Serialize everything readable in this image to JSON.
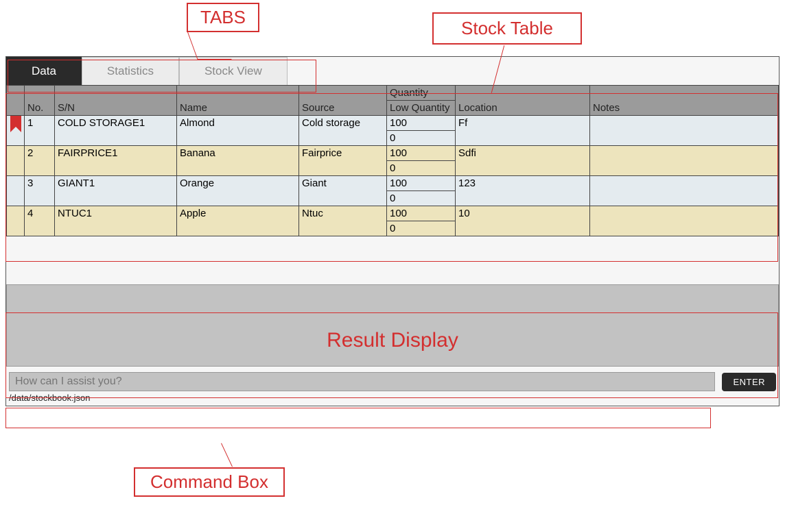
{
  "annotations": {
    "tabs_label": "TABS",
    "stock_label": "Stock Table",
    "result_label": "Result Display",
    "cmd_label": "Command Box"
  },
  "tabs": [
    {
      "label": "Data",
      "active": true
    },
    {
      "label": "Statistics",
      "active": false
    },
    {
      "label": "Stock View",
      "active": false
    }
  ],
  "table": {
    "headers": {
      "no": "No.",
      "sn": "S/N",
      "name": "Name",
      "source": "Source",
      "qty_top": "Quantity",
      "qty_bottom": "Low Quantity",
      "location": "Location",
      "notes": "Notes"
    },
    "rows": [
      {
        "bookmarked": true,
        "no": "1",
        "sn": "COLD STORAGE1",
        "name": "Almond",
        "source": "Cold storage",
        "qty": "100",
        "lowqty": "0",
        "location": "Ff",
        "notes": ""
      },
      {
        "bookmarked": false,
        "no": "2",
        "sn": "FAIRPRICE1",
        "name": "Banana",
        "source": "Fairprice",
        "qty": "100",
        "lowqty": "0",
        "location": "Sdfi",
        "notes": ""
      },
      {
        "bookmarked": false,
        "no": "3",
        "sn": "GIANT1",
        "name": "Orange",
        "source": "Giant",
        "qty": "100",
        "lowqty": "0",
        "location": "123",
        "notes": ""
      },
      {
        "bookmarked": false,
        "no": "4",
        "sn": "NTUC1",
        "name": "Apple",
        "source": "Ntuc",
        "qty": "100",
        "lowqty": "0",
        "location": "10",
        "notes": ""
      }
    ]
  },
  "command": {
    "placeholder": "How can I assist you?",
    "enter_label": "ENTER",
    "path": "/data/stockbook.json"
  }
}
